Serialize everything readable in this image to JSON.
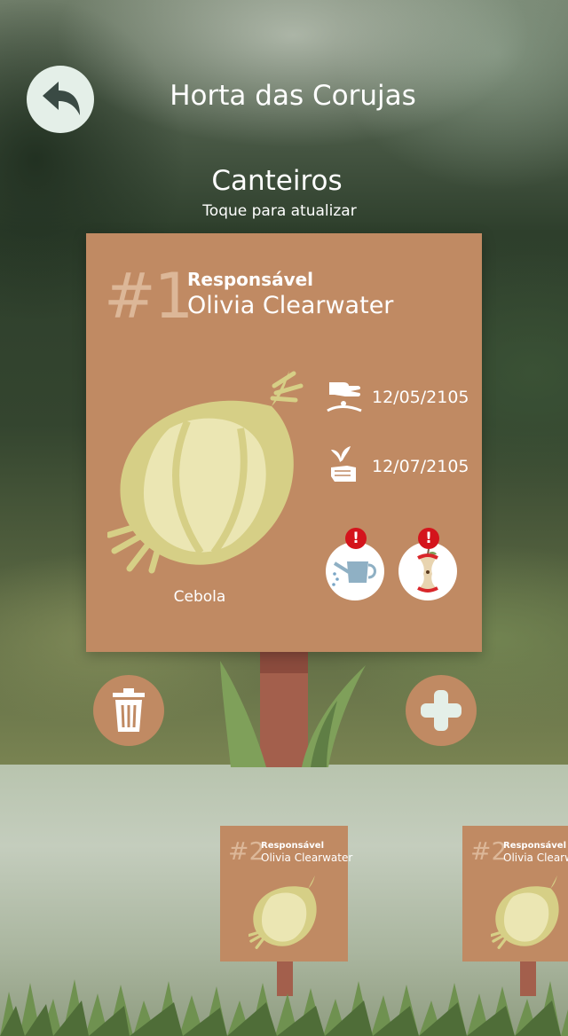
{
  "header": {
    "title": "Horta das Corujas",
    "back_icon": "back-arrow-icon"
  },
  "section": {
    "title": "Canteiros",
    "subtitle": "Toque para atualizar"
  },
  "main_sign": {
    "number": "#1",
    "responsible_label": "Responsável",
    "responsible_name": "Olivia Clearwater",
    "vegetable": "Cebola",
    "planted_date": "12/05/2105",
    "harvest_date": "12/07/2105",
    "alerts": {
      "water_alert": "!",
      "compost_alert": "!"
    }
  },
  "actions": {
    "delete_icon": "trash-icon",
    "add_icon": "plus-icon"
  },
  "preview_signs": [
    {
      "number": "#2",
      "responsible_label": "Responsável",
      "responsible_name": "Olivia Clearwater"
    },
    {
      "number": "#2",
      "responsible_label": "Responsável",
      "responsible_name": "Olivia Clearwater"
    }
  ],
  "colors": {
    "sign": "#c08a63",
    "post": "#a35f4c",
    "onion": "#d6cf86",
    "button_light": "#e4efe8",
    "alert": "#d4141c"
  }
}
